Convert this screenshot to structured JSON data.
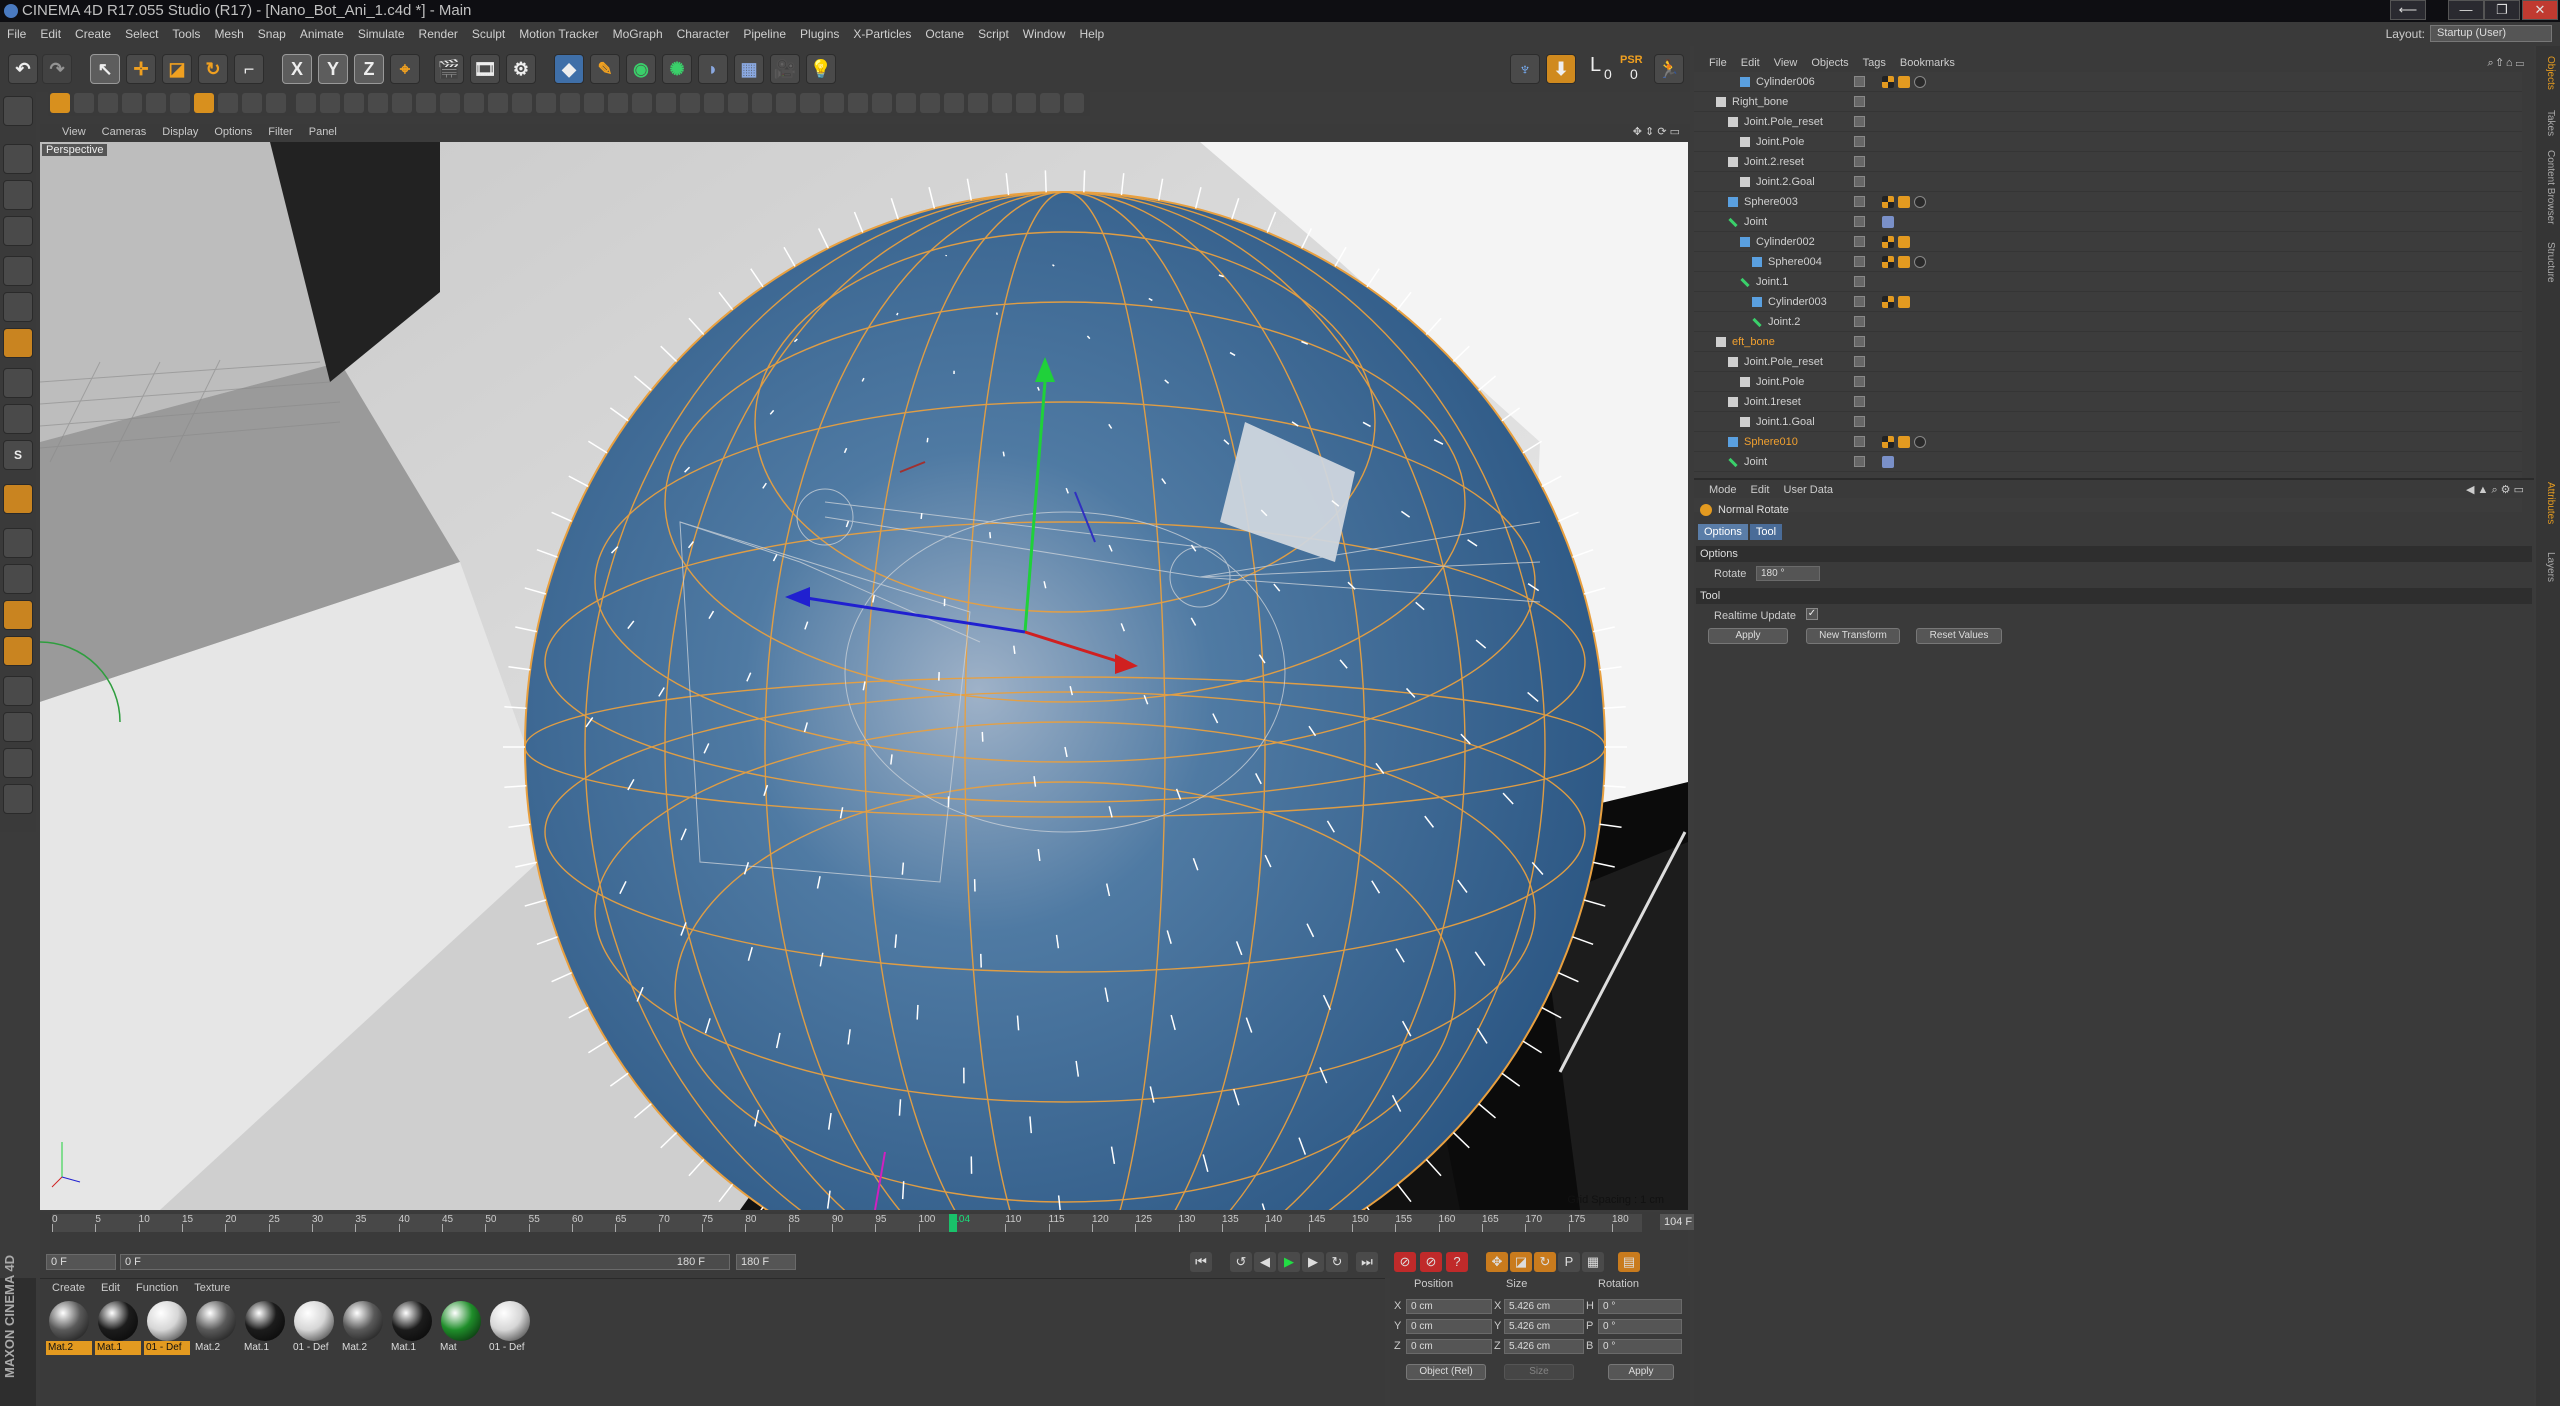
{
  "window": {
    "title": "CINEMA 4D R17.055 Studio (R17) - [Nano_Bot_Ani_1.c4d *] - Main",
    "controls": [
      "⟵",
      "—",
      "❐",
      "✕"
    ]
  },
  "menubar": {
    "items": [
      "File",
      "Edit",
      "Create",
      "Select",
      "Tools",
      "Mesh",
      "Snap",
      "Animate",
      "Simulate",
      "Render",
      "Sculpt",
      "Motion Tracker",
      "MoGraph",
      "Character",
      "Pipeline",
      "Plugins",
      "X-Particles",
      "Octane",
      "Script",
      "Window",
      "Help"
    ],
    "layout_label": "Layout:",
    "layout_value": "Startup (User)"
  },
  "toolbar": {
    "axis_x": "X",
    "axis_y": "Y",
    "axis_z": "Z",
    "psr_label": "PSR",
    "psr_value": "0",
    "level_value": "0"
  },
  "viewport": {
    "menu": [
      "View",
      "Cameras",
      "Display",
      "Options",
      "Filter",
      "Panel"
    ],
    "camera": "Perspective",
    "grid_spacing": "Grid Spacing : 1 cm"
  },
  "timeline": {
    "ticks": [
      "0",
      "5",
      "10",
      "15",
      "20",
      "25",
      "30",
      "35",
      "40",
      "45",
      "50",
      "55",
      "60",
      "65",
      "70",
      "75",
      "80",
      "85",
      "90",
      "95",
      "100",
      "104",
      "110",
      "115",
      "120",
      "125",
      "130",
      "135",
      "140",
      "145",
      "150",
      "155",
      "160",
      "165",
      "170",
      "175",
      "180"
    ],
    "current_frame": "104",
    "current_frame_field": "104 F",
    "start_field": "0 F",
    "range_start": "0 F",
    "range_end": "180 F",
    "end_field": "180 F"
  },
  "materials": {
    "menu": [
      "Create",
      "Edit",
      "Function",
      "Texture"
    ],
    "items": [
      {
        "label": "Mat.2",
        "color": "#5a5a5a",
        "selected": true
      },
      {
        "label": "Mat.1",
        "color": "#1c1c1c",
        "selected": true
      },
      {
        "label": "01 - Def",
        "color": "#d6d6d6",
        "selected": true
      },
      {
        "label": "Mat.2",
        "color": "#5a5a5a",
        "selected": false
      },
      {
        "label": "Mat.1",
        "color": "#1c1c1c",
        "selected": false
      },
      {
        "label": "01 - Def",
        "color": "#d6d6d6",
        "selected": false
      },
      {
        "label": "Mat.2",
        "color": "#5a5a5a",
        "selected": false
      },
      {
        "label": "Mat.1",
        "color": "#1c1c1c",
        "selected": false
      },
      {
        "label": "Mat",
        "color": "#1f8e2a",
        "selected": false
      },
      {
        "label": "01 - Def",
        "color": "#d6d6d6",
        "selected": false
      }
    ],
    "brand": "MAXON CINEMA 4D"
  },
  "coordinates": {
    "headers": [
      "Position",
      "Size",
      "Rotation"
    ],
    "rows": [
      {
        "axis": "X",
        "pos": "0 cm",
        "size_axis": "X",
        "size": "5.426 cm",
        "rot_axis": "H",
        "rot": "0 °"
      },
      {
        "axis": "Y",
        "pos": "0 cm",
        "size_axis": "Y",
        "size": "5.426 cm",
        "rot_axis": "P",
        "rot": "0 °"
      },
      {
        "axis": "Z",
        "pos": "0 cm",
        "size_axis": "Z",
        "size": "5.426 cm",
        "rot_axis": "B",
        "rot": "0 °"
      }
    ],
    "mode": "Object (Rel)",
    "size_mode": "Size",
    "apply": "Apply"
  },
  "objects": {
    "menu": [
      "File",
      "Edit",
      "View",
      "Objects",
      "Tags",
      "Bookmarks"
    ],
    "rows": [
      {
        "name": "Cylinder006",
        "indent": 2,
        "highlight": false,
        "icon": "cylinder",
        "tags": [
          "checker",
          "orange",
          "sphere"
        ]
      },
      {
        "name": "Right_bone",
        "indent": 0,
        "highlight": false,
        "icon": "null",
        "tags": []
      },
      {
        "name": "Joint.Pole_reset",
        "indent": 1,
        "highlight": false,
        "icon": "null",
        "tags": []
      },
      {
        "name": "Joint.Pole",
        "indent": 2,
        "highlight": false,
        "icon": "null",
        "tags": []
      },
      {
        "name": "Joint.2.reset",
        "indent": 1,
        "highlight": false,
        "icon": "null",
        "tags": []
      },
      {
        "name": "Joint.2.Goal",
        "indent": 2,
        "highlight": false,
        "icon": "null",
        "tags": []
      },
      {
        "name": "Sphere003",
        "indent": 1,
        "highlight": false,
        "icon": "cylinder",
        "tags": [
          "checker",
          "orange",
          "sphere"
        ]
      },
      {
        "name": "Joint",
        "indent": 1,
        "highlight": false,
        "icon": "joint",
        "tags": [
          "ik"
        ]
      },
      {
        "name": "Cylinder002",
        "indent": 2,
        "highlight": false,
        "icon": "cylinder",
        "tags": [
          "checker",
          "orange"
        ]
      },
      {
        "name": "Sphere004",
        "indent": 3,
        "highlight": false,
        "icon": "cylinder",
        "tags": [
          "checker",
          "orange",
          "sphere"
        ]
      },
      {
        "name": "Joint.1",
        "indent": 2,
        "highlight": false,
        "icon": "joint",
        "tags": []
      },
      {
        "name": "Cylinder003",
        "indent": 3,
        "highlight": false,
        "icon": "cylinder",
        "tags": [
          "checker",
          "orange"
        ]
      },
      {
        "name": "Joint.2",
        "indent": 3,
        "highlight": false,
        "icon": "joint",
        "tags": []
      },
      {
        "name": "eft_bone",
        "indent": 0,
        "highlight": true,
        "icon": "null",
        "tags": []
      },
      {
        "name": "Joint.Pole_reset",
        "indent": 1,
        "highlight": false,
        "icon": "null",
        "tags": []
      },
      {
        "name": "Joint.Pole",
        "indent": 2,
        "highlight": false,
        "icon": "null",
        "tags": []
      },
      {
        "name": "Joint.1reset",
        "indent": 1,
        "highlight": false,
        "icon": "null",
        "tags": []
      },
      {
        "name": "Joint.1.Goal",
        "indent": 2,
        "highlight": false,
        "icon": "null",
        "tags": []
      },
      {
        "name": "Sphere010",
        "indent": 1,
        "highlight": true,
        "icon": "cylinder",
        "tags": [
          "checker",
          "orange",
          "sphere"
        ]
      },
      {
        "name": "Joint",
        "indent": 1,
        "highlight": false,
        "icon": "joint",
        "tags": [
          "ik"
        ]
      }
    ]
  },
  "attributes": {
    "menu": [
      "Mode",
      "Edit",
      "User Data"
    ],
    "title": "Normal Rotate",
    "tabs": [
      "Options",
      "Tool"
    ],
    "options_section": "Options",
    "rotate_label": "Rotate",
    "rotate_value": "180 °",
    "tool_section": "Tool",
    "realtime_label": "Realtime Update",
    "realtime_checked": "✓",
    "buttons": [
      "Apply",
      "New Transform",
      "Reset Values"
    ]
  },
  "side_tabs": [
    "Objects",
    "Takes",
    "Content Browser",
    "Structure",
    "Attributes",
    "Layers"
  ],
  "colors": {
    "accent_orange": "#e39a20",
    "sphere_blue": "#2f5f8f",
    "wire_orange": "#e8a040",
    "selection_blue": "#5a7da8"
  }
}
